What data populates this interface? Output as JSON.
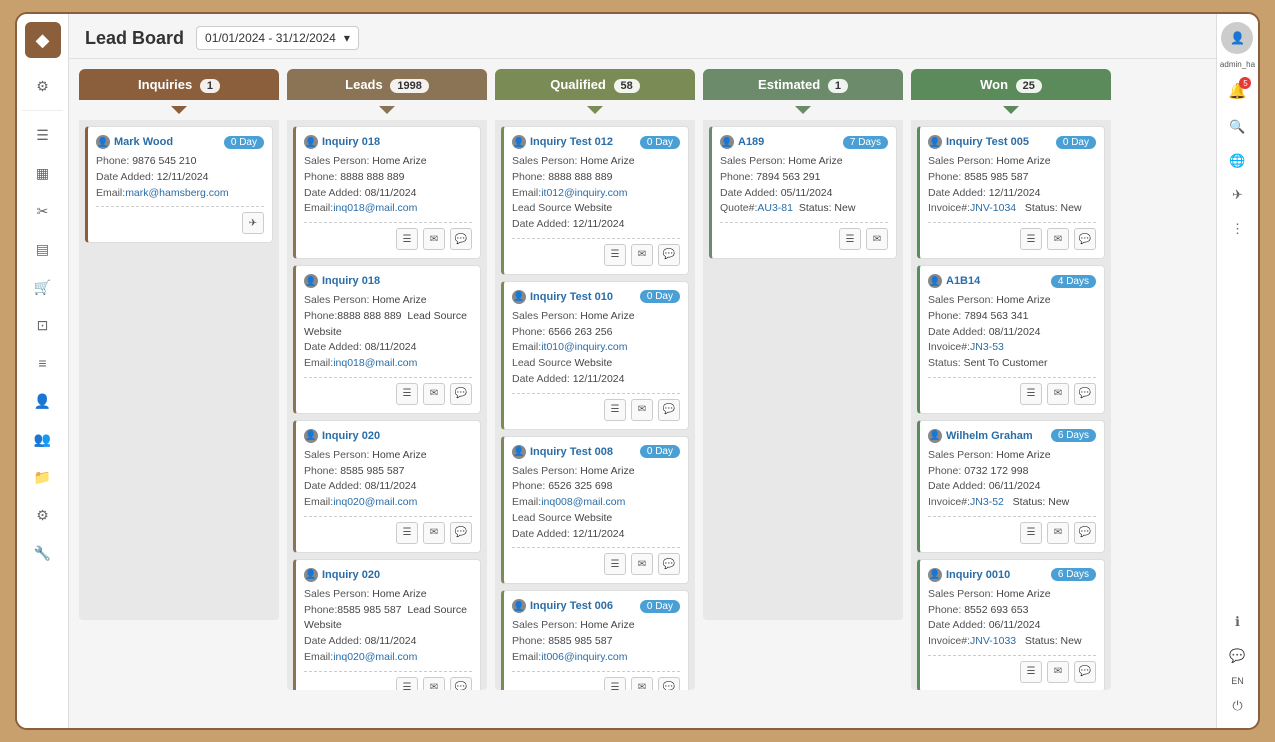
{
  "page": {
    "title": "Lead Board",
    "dateFilter": "01/01/2024 - 31/12/2024"
  },
  "columns": [
    {
      "id": "inquiries",
      "label": "Inquiries",
      "count": "1",
      "colorClass": "col-inquiries",
      "cards": [
        {
          "name": "Mark Wood",
          "isLink": false,
          "dayBadge": "0 Day",
          "fields": [
            {
              "label": "Phone:",
              "value": "9876 545 210"
            },
            {
              "label": "Date Added:",
              "value": "12/11/2024"
            },
            {
              "label": "Email:",
              "value": "mark@hamsberg.com",
              "isEmail": true
            }
          ],
          "actions": [
            "send"
          ]
        }
      ]
    },
    {
      "id": "leads",
      "label": "Leads",
      "count": "1998",
      "colorClass": "col-leads",
      "cards": [
        {
          "name": "Inquiry 018",
          "isLink": true,
          "dayBadge": null,
          "fields": [
            {
              "label": "Sales Person:",
              "value": "Home Arize"
            },
            {
              "label": "Phone:",
              "value": "8888 888 889"
            },
            {
              "label": "Date Added:",
              "value": "08/11/2024"
            },
            {
              "label": "Email:",
              "value": "inq018@mail.com",
              "isEmail": true
            }
          ],
          "actions": [
            "list",
            "email",
            "chat"
          ]
        },
        {
          "name": "Inquiry 018",
          "isLink": true,
          "dayBadge": null,
          "fields": [
            {
              "label": "Sales Person:",
              "value": "Home Arize"
            },
            {
              "label": "Phone:",
              "value": "8888 888 889",
              "extra": "Lead Source Website"
            },
            {
              "label": "Date Added:",
              "value": "08/11/2024"
            },
            {
              "label": "Email:",
              "value": "inq018@mail.com",
              "isEmail": true
            }
          ],
          "actions": [
            "list",
            "email",
            "chat"
          ]
        },
        {
          "name": "Inquiry 020",
          "isLink": true,
          "dayBadge": null,
          "fields": [
            {
              "label": "Sales Person:",
              "value": "Home Arize"
            },
            {
              "label": "Phone:",
              "value": "8585 985 587"
            },
            {
              "label": "Date Added:",
              "value": "08/11/2024"
            },
            {
              "label": "Email:",
              "value": "inq020@mail.com",
              "isEmail": true
            }
          ],
          "actions": [
            "list",
            "email",
            "chat"
          ]
        },
        {
          "name": "Inquiry 020",
          "isLink": true,
          "dayBadge": null,
          "fields": [
            {
              "label": "Sales Person:",
              "value": "Home Arize"
            },
            {
              "label": "Phone:",
              "value": "8585 985 587",
              "extra": "Lead Source Website"
            },
            {
              "label": "Date Added:",
              "value": "08/11/2024"
            },
            {
              "label": "Email:",
              "value": "inq020@mail.com",
              "isEmail": true
            }
          ],
          "actions": [
            "list",
            "email",
            "chat"
          ]
        }
      ]
    },
    {
      "id": "qualified",
      "label": "Qualified",
      "count": "58",
      "colorClass": "col-qualified",
      "cards": [
        {
          "name": "Inquiry Test 012",
          "isLink": true,
          "dayBadge": "0 Day",
          "fields": [
            {
              "label": "Sales Person:",
              "value": "Home Arize"
            },
            {
              "label": "Phone:",
              "value": "8888 888 889"
            },
            {
              "label": "Email:",
              "value": "it012@inquiry.com",
              "isEmail": true
            },
            {
              "label": "Lead Source",
              "value": "Website"
            },
            {
              "label": "Date Added:",
              "value": "12/11/2024"
            }
          ],
          "actions": [
            "list",
            "email",
            "chat"
          ]
        },
        {
          "name": "Inquiry Test 010",
          "isLink": true,
          "dayBadge": "0 Day",
          "fields": [
            {
              "label": "Sales Person:",
              "value": "Home Arize"
            },
            {
              "label": "Phone:",
              "value": "6566 263 256"
            },
            {
              "label": "Email:",
              "value": "it010@inquiry.com",
              "isEmail": true
            },
            {
              "label": "Lead Source",
              "value": "Website"
            },
            {
              "label": "Date Added:",
              "value": "12/11/2024"
            }
          ],
          "actions": [
            "list",
            "email",
            "chat"
          ]
        },
        {
          "name": "Inquiry Test 008",
          "isLink": true,
          "dayBadge": "0 Day",
          "fields": [
            {
              "label": "Sales Person:",
              "value": "Home Arize"
            },
            {
              "label": "Phone:",
              "value": "6526 325 698"
            },
            {
              "label": "Email:",
              "value": "inq008@mail.com",
              "isEmail": true
            },
            {
              "label": "Lead Source",
              "value": "Website"
            },
            {
              "label": "Date Added:",
              "value": "12/11/2024"
            }
          ],
          "actions": [
            "list",
            "email",
            "chat"
          ]
        },
        {
          "name": "Inquiry Test 006",
          "isLink": true,
          "dayBadge": "0 Day",
          "fields": [
            {
              "label": "Sales Person:",
              "value": "Home Arize"
            },
            {
              "label": "Phone:",
              "value": "8585 985 587"
            },
            {
              "label": "Email:",
              "value": "it006@inquiry.com",
              "isEmail": true
            }
          ],
          "actions": [
            "list",
            "email",
            "chat"
          ]
        }
      ]
    },
    {
      "id": "estimated",
      "label": "Estimated",
      "count": "1",
      "colorClass": "col-estimated",
      "cards": [
        {
          "name": "A189",
          "isLink": true,
          "dayBadge": "7 Days",
          "fields": [
            {
              "label": "Sales Person:",
              "value": "Home Arize"
            },
            {
              "label": "Phone:",
              "value": "7894 563 291"
            },
            {
              "label": "Date Added:",
              "value": "05/11/2024"
            },
            {
              "label": "Quote#:",
              "value": "AU3-81",
              "quoteLink": true,
              "extra": "Status: New"
            }
          ],
          "actions": [
            "list",
            "email"
          ]
        }
      ]
    },
    {
      "id": "won",
      "label": "Won",
      "count": "25",
      "colorClass": "col-won",
      "cards": [
        {
          "name": "Inquiry Test 005",
          "isLink": true,
          "dayBadge": "0 Day",
          "fields": [
            {
              "label": "Sales Person:",
              "value": "Home Arize"
            },
            {
              "label": "Phone:",
              "value": "8585 985 587"
            },
            {
              "label": "Date Added:",
              "value": "12/11/2024"
            },
            {
              "label": "Invoice#:",
              "value": "JNV-1034",
              "invoiceLink": true,
              "extra": "Status: New"
            }
          ],
          "actions": [
            "list",
            "email",
            "chat"
          ]
        },
        {
          "name": "A1B14",
          "isLink": true,
          "dayBadge": "4 Days",
          "fields": [
            {
              "label": "Sales Person:",
              "value": "Home Arize"
            },
            {
              "label": "Phone:",
              "value": "7894 563 341"
            },
            {
              "label": "Date Added:",
              "value": "08/11/2024"
            },
            {
              "label": "Invoice#:",
              "value": "JN3-53",
              "invoiceLink": true
            },
            {
              "label": "Status:",
              "value": "Sent To Customer"
            }
          ],
          "actions": [
            "list",
            "email",
            "chat"
          ]
        },
        {
          "name": "Wilhelm Graham",
          "isLink": true,
          "dayBadge": "6 Days",
          "fields": [
            {
              "label": "Sales Person:",
              "value": "Home Arize"
            },
            {
              "label": "Phone:",
              "value": "0732 172 998"
            },
            {
              "label": "Date Added:",
              "value": "06/11/2024"
            },
            {
              "label": "Invoice#:",
              "value": "JN3-52",
              "invoiceLink": true,
              "extra": "Status: New"
            }
          ],
          "actions": [
            "list",
            "email",
            "chat"
          ]
        },
        {
          "name": "Inquiry 0010",
          "isLink": true,
          "dayBadge": "6 Days",
          "fields": [
            {
              "label": "Sales Person:",
              "value": "Home Arize"
            },
            {
              "label": "Phone:",
              "value": "8552 693 653"
            },
            {
              "label": "Date Added:",
              "value": "06/11/2024"
            },
            {
              "label": "Invoice#:",
              "value": "JNV-1033",
              "invoiceLink": true,
              "extra": "Status: New"
            }
          ],
          "actions": [
            "list",
            "email",
            "chat"
          ]
        }
      ]
    }
  ],
  "sidebar": {
    "icons": [
      "filter",
      "list",
      "calendar",
      "tools",
      "chart",
      "cart",
      "camera",
      "document",
      "person",
      "folder",
      "settings",
      "wrench"
    ]
  },
  "rightSidebar": {
    "userLabel": "admin_ha",
    "icons": [
      "bell",
      "search",
      "globe",
      "send",
      "more"
    ]
  }
}
